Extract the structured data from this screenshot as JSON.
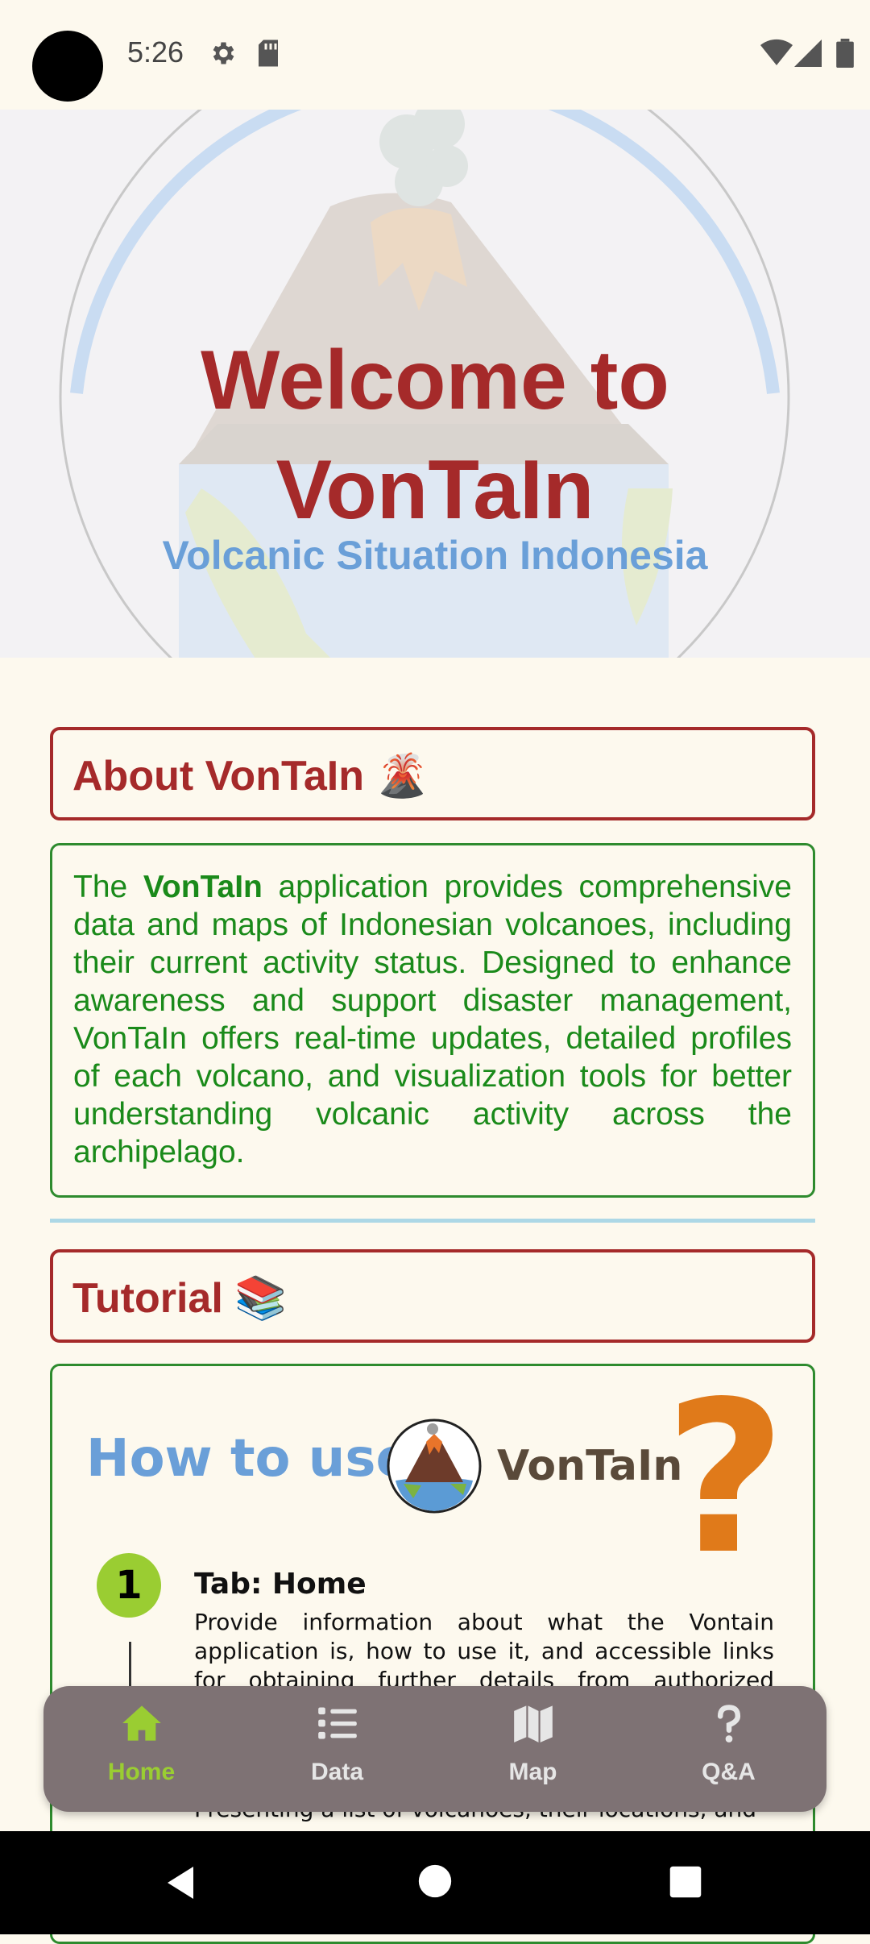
{
  "status_bar": {
    "time": "5:26",
    "icons": [
      "settings-icon",
      "sd-card-icon",
      "wifi-icon",
      "signal-icon",
      "battery-icon"
    ]
  },
  "hero": {
    "title_line1": "Welcome to",
    "title_line2": "VonTaIn",
    "subtitle": "Volcanic Situation Indonesia"
  },
  "about": {
    "heading": "About VonTaIn 🌋",
    "body_prefix": "The ",
    "body_brand": "VonTaIn",
    "body_rest": " application provides comprehensive data and maps of Indonesian volcanoes, including their current activity status. Designed to enhance awareness and support disaster management, VonTaIn offers real-time updates, detailed profiles of each volcano, and visualization tools for better understanding volcanic activity across the archipelago."
  },
  "tutorial": {
    "heading": "Tutorial 📚",
    "howto": "How to use",
    "brand": "VonTaIn",
    "qmark": "?",
    "steps": [
      {
        "number": "1",
        "title": "Tab: Home",
        "description": "Provide information about what the Vontain application is, how to use it, and accessible links for obtaining further details from authorized organizations."
      },
      {
        "description": "Presenting a list of volcanoes, their locations, and"
      }
    ]
  },
  "bottom_nav": {
    "items": [
      {
        "label": "Home",
        "icon": "home-icon",
        "active": true
      },
      {
        "label": "Data",
        "icon": "list-icon",
        "active": false
      },
      {
        "label": "Map",
        "icon": "map-icon",
        "active": false
      },
      {
        "label": "Q&A",
        "icon": "question-icon",
        "active": false
      }
    ]
  },
  "colors": {
    "accent_red": "#a52a2a",
    "accent_green": "#2e8b2e",
    "accent_blue": "#6a9fd8",
    "nav_active": "#9acd32",
    "nav_bg": "#7e7274"
  }
}
